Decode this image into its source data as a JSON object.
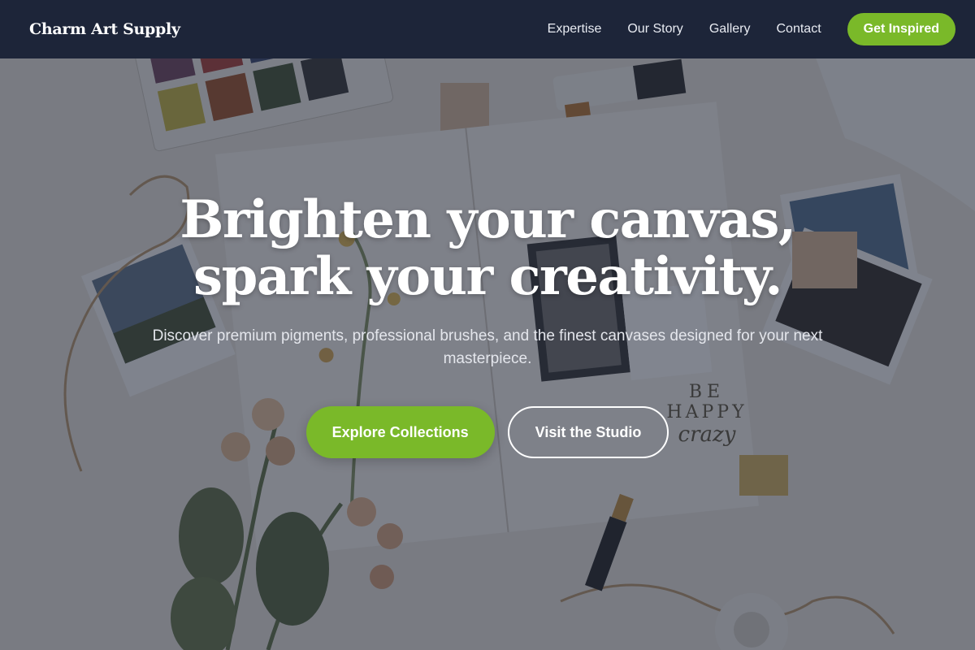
{
  "brand": {
    "name": "Charm Art Supply"
  },
  "nav": {
    "links": [
      {
        "label": "Expertise"
      },
      {
        "label": "Our Story"
      },
      {
        "label": "Gallery"
      },
      {
        "label": "Contact"
      }
    ],
    "cta_label": "Get Inspired"
  },
  "hero": {
    "headline_line1": "Brighten your canvas,",
    "headline_line2": "spark your creativity.",
    "subhead": "Discover premium pigments, professional brushes, and the finest canvases designed for your next masterpiece.",
    "primary_cta": "Explore Collections",
    "secondary_cta": "Visit the Studio",
    "background_image": "Flat-lay of an open art journal with watercolor palette, paint tube, dried roses, polaroid photos, twine and stamps",
    "sticker_text": {
      "line1": "BE",
      "line2": "HAPPY",
      "line3": "crazy"
    }
  },
  "colors": {
    "nav_background": "#1d2539",
    "accent_green": "#7ab929",
    "text_white": "#ffffff",
    "overlay": "rgba(38,44,62,0.58)"
  }
}
